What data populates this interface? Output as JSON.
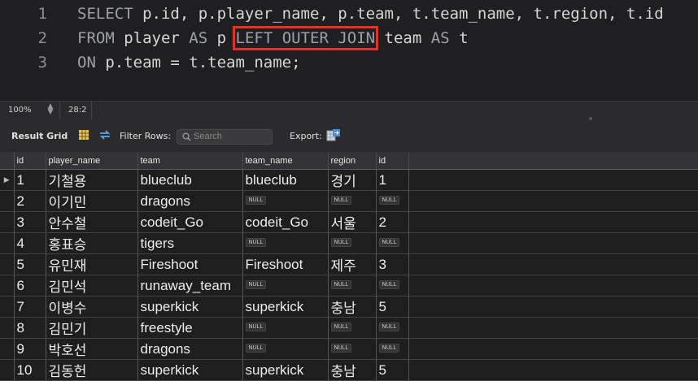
{
  "editor": {
    "line_numbers": [
      "1",
      "2",
      "3"
    ],
    "lines": [
      [
        {
          "t": "SELECT",
          "kw": true
        },
        {
          "t": " p.id, p.player_name, p.team, t.team_name, t.region, t.id"
        }
      ],
      [
        {
          "t": "FROM",
          "kw": true
        },
        {
          "t": " player "
        },
        {
          "t": "AS",
          "kw": true
        },
        {
          "t": " p "
        },
        {
          "t": "LEFT OUTER JOIN",
          "kw": true,
          "hl": true
        },
        {
          "t": " team "
        },
        {
          "t": "AS",
          "kw": true
        },
        {
          "t": " t"
        }
      ],
      [
        {
          "t": "ON",
          "kw": true
        },
        {
          "t": " p.team = t.team_name;"
        }
      ]
    ]
  },
  "status": {
    "zoom": "100%",
    "cursor": "28:2"
  },
  "toolbar": {
    "result_grid_label": "Result Grid",
    "filter_label": "Filter Rows:",
    "search_placeholder": "Search",
    "export_label": "Export:"
  },
  "table": {
    "columns": [
      "id",
      "player_name",
      "team",
      "team_name",
      "region",
      "id"
    ],
    "null_label": "NULL",
    "rows": [
      [
        "1",
        "기철용",
        "blueclub",
        "blueclub",
        "경기",
        "1"
      ],
      [
        "2",
        "이기민",
        "dragons",
        null,
        null,
        null
      ],
      [
        "3",
        "안수철",
        "codeit_Go",
        "codeit_Go",
        "서울",
        "2"
      ],
      [
        "4",
        "홍표승",
        "tigers",
        null,
        null,
        null
      ],
      [
        "5",
        "유민재",
        "Fireshoot",
        "Fireshoot",
        "제주",
        "3"
      ],
      [
        "6",
        "김민석",
        "runaway_team",
        null,
        null,
        null
      ],
      [
        "7",
        "이병수",
        "superkick",
        "superkick",
        "충남",
        "5"
      ],
      [
        "8",
        "김민기",
        "freestyle",
        null,
        null,
        null
      ],
      [
        "9",
        "박호선",
        "dragons",
        null,
        null,
        null
      ],
      [
        "10",
        "김동헌",
        "superkick",
        "superkick",
        "충남",
        "5"
      ]
    ]
  },
  "colors": {
    "highlight_box": "#e0332a",
    "editor_bg": "#1f1f21",
    "grid_bg": "#1e1e1e"
  }
}
